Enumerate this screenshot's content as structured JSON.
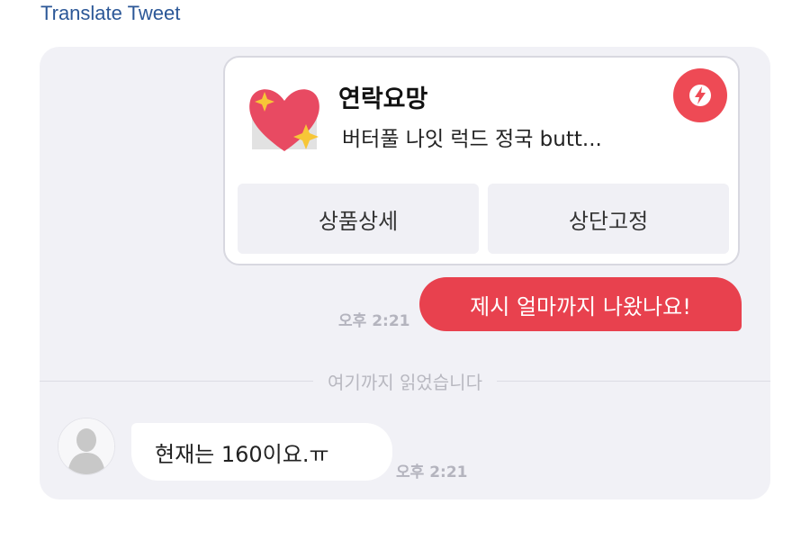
{
  "header": {
    "translate_label": "Translate Tweet"
  },
  "product_card": {
    "title": "연락요망",
    "description": "버터풀 나잇 럭드 정국 butt...",
    "buttons": {
      "detail_label": "상품상세",
      "pin_label": "상단고정"
    },
    "thumb_icon": "sparkling-heart-icon",
    "badge_icon": "flash-icon"
  },
  "messages": {
    "sent": {
      "text": "제시 얼마까지 나왔나요!",
      "time": "오후 2:21"
    },
    "read_divider": "여기까지 읽었습니다",
    "received": {
      "text": "현재는 160이요.ㅠ",
      "time": "오후 2:21"
    }
  },
  "colors": {
    "accent": "#e8414e",
    "panel_bg": "#f1f1f6",
    "link": "#2b5797"
  }
}
